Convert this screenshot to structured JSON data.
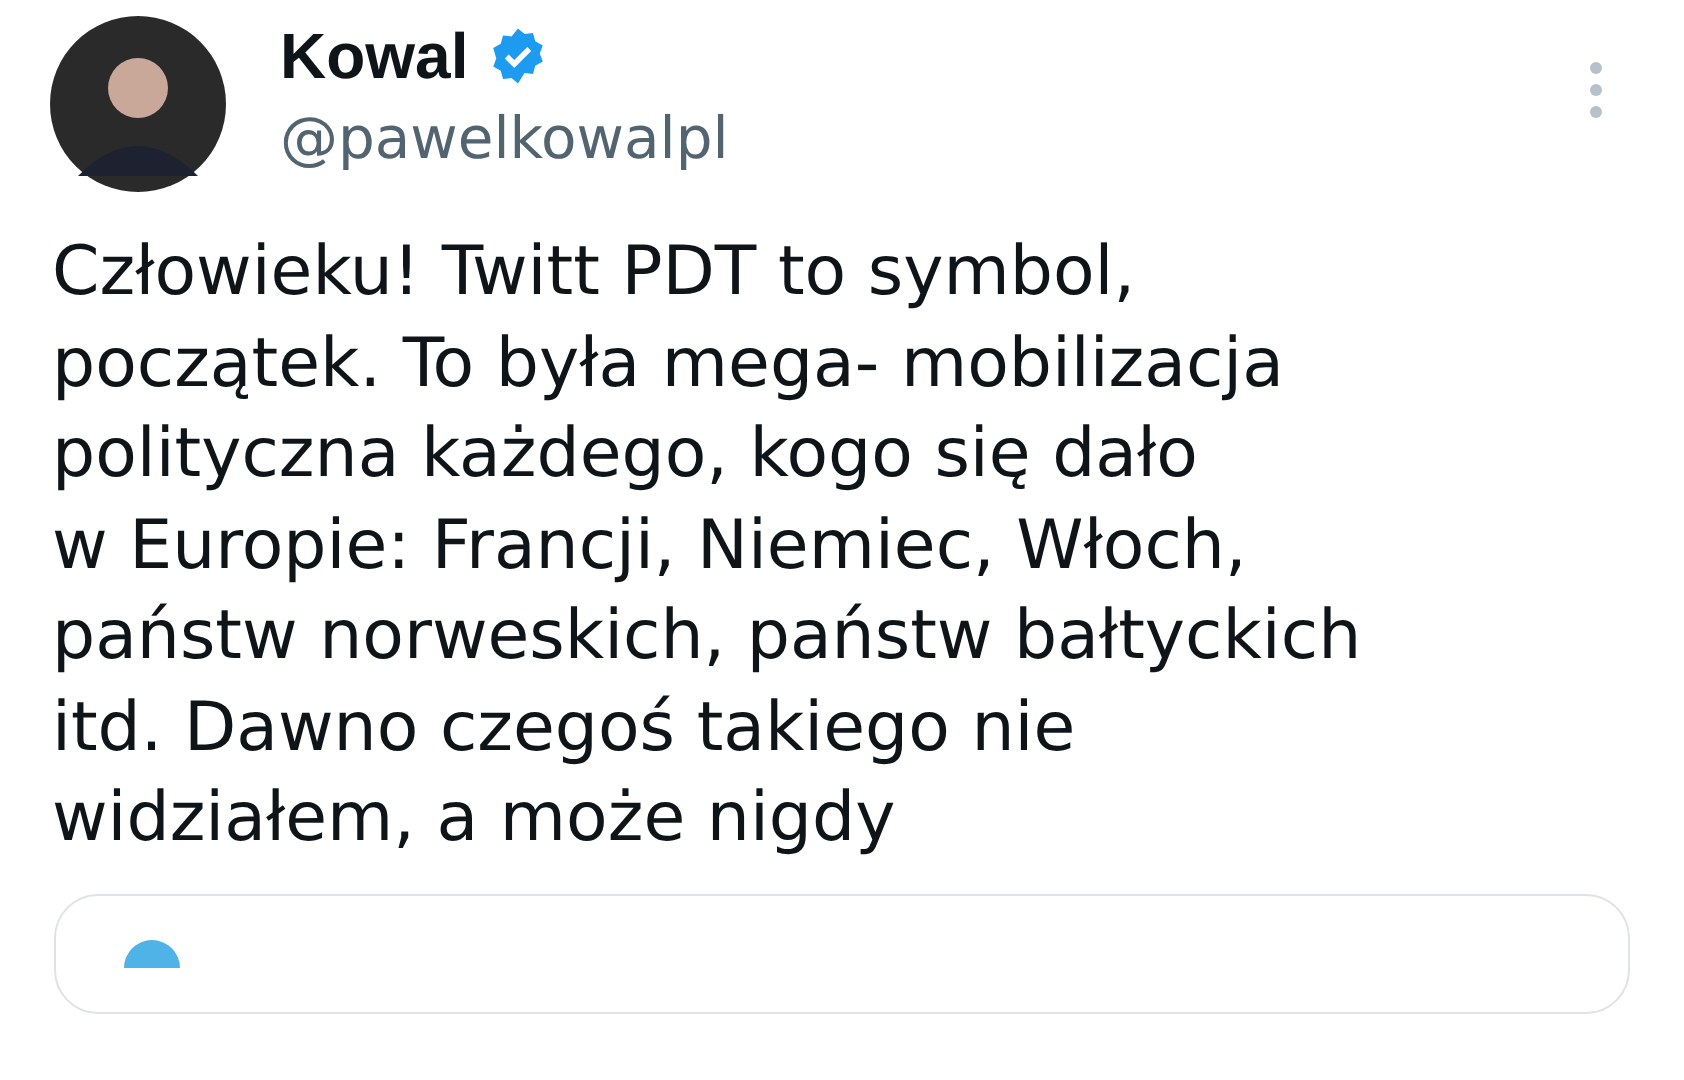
{
  "author": {
    "name": "Kowal",
    "verified": true,
    "handle": "@pawelkowalpl"
  },
  "body": "Człowieku! Twitt PDT to symbol,\npoczątek. To była mega- mobilizacja\npolityczna każdego, kogo się dało\nw Europie: Francji, Niemiec, Włoch,\npaństw norweskich, państw bałtyckich\nitd. Dawno czegoś takiego nie\nwidziałem, a może nigdy"
}
